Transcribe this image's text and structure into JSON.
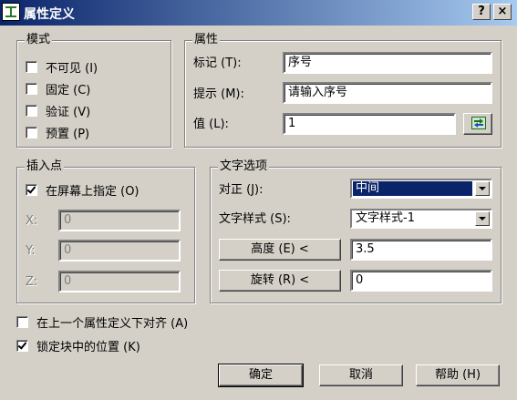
{
  "window": {
    "title": "属性定义",
    "help_button": "?",
    "close_button": "×"
  },
  "mode": {
    "legend": "模式",
    "options": [
      {
        "label": "不可见 (I)",
        "checked": false
      },
      {
        "label": "固定 (C)",
        "checked": false
      },
      {
        "label": "验证 (V)",
        "checked": false
      },
      {
        "label": "预置 (P)",
        "checked": false
      }
    ]
  },
  "attribute": {
    "legend": "属性",
    "tag_label": "标记 (T):",
    "tag_value": "序号",
    "prompt_label": "提示 (M):",
    "prompt_value": "请输入序号",
    "value_label": "值 (L):",
    "value_value": "1",
    "field_button_icon": "insert-field-icon"
  },
  "insertion": {
    "legend": "插入点",
    "specify_label": "在屏幕上指定 (O)",
    "specify_checked": true,
    "x_label": "X:",
    "x_value": "0",
    "y_label": "Y:",
    "y_value": "0",
    "z_label": "Z:",
    "z_value": "0"
  },
  "text_options": {
    "legend": "文字选项",
    "justify_label": "对正 (J):",
    "justify_value": "中间",
    "style_label": "文字样式 (S):",
    "style_value": "文字样式-1",
    "height_button": "高度 (E)  <",
    "height_value": "3.5",
    "rotation_button": "旋转 (R)  <",
    "rotation_value": "0"
  },
  "bottom_options": [
    {
      "label": "在上一个属性定义下对齐 (A)",
      "checked": false
    },
    {
      "label": "锁定块中的位置 (K)",
      "checked": true
    }
  ],
  "buttons": {
    "ok": "确定",
    "cancel": "取消",
    "help": "帮助 (H)"
  },
  "colors": {
    "title_bar": "#0a246a",
    "dialog_face": "#d4d0c8",
    "selection": "#0a246a"
  }
}
